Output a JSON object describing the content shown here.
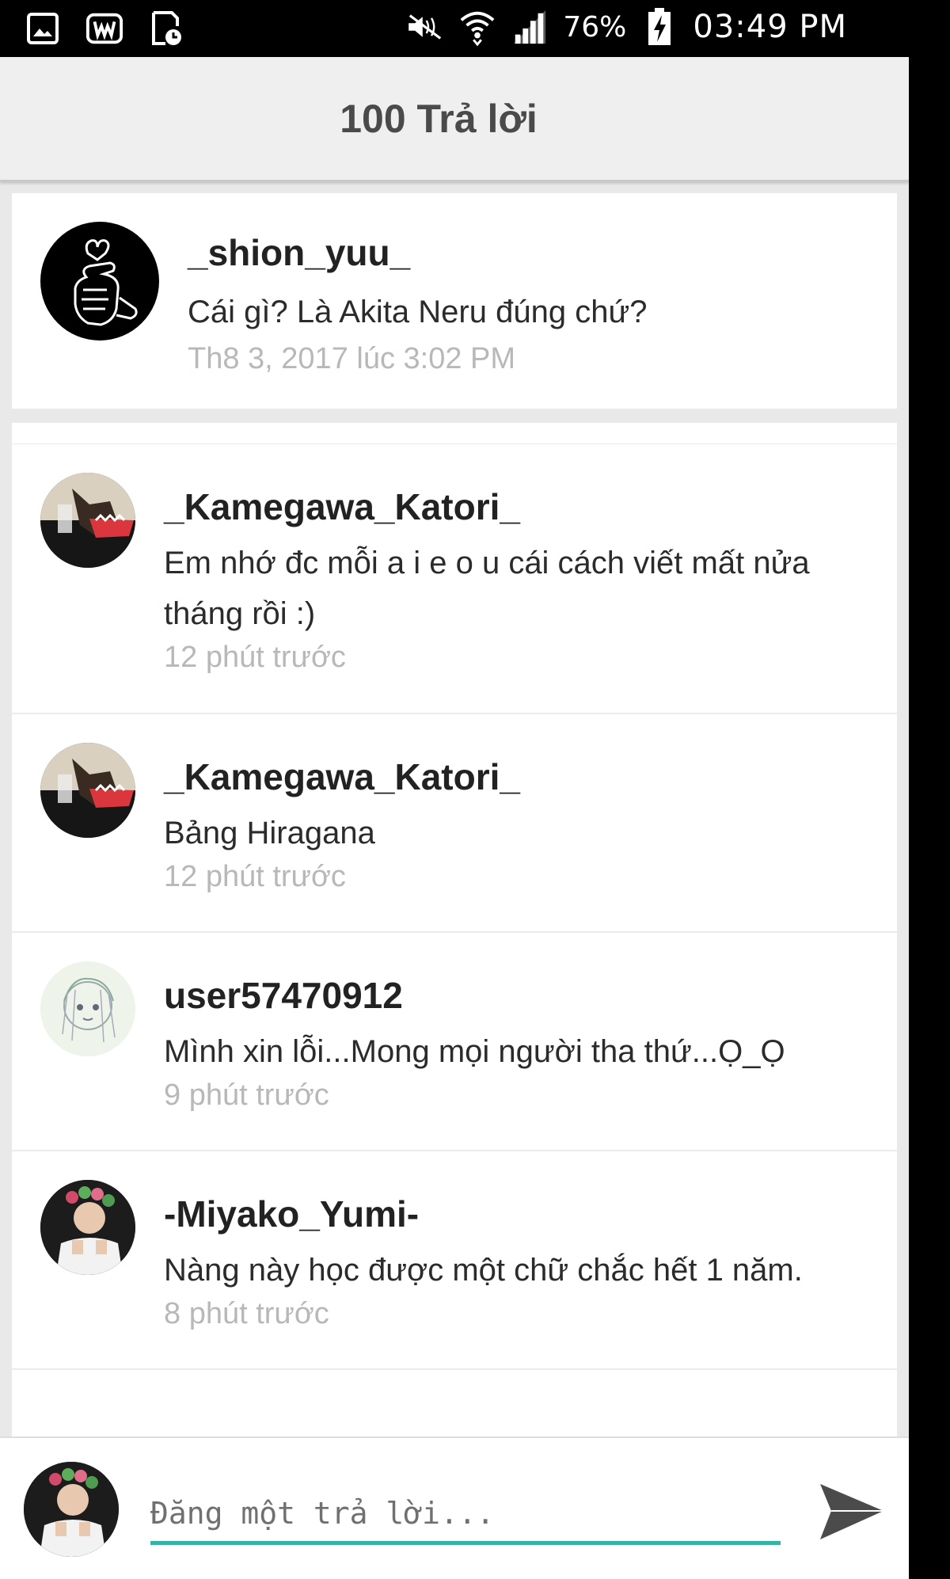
{
  "status_bar": {
    "battery_percent": "76%",
    "time": "03:49 PM",
    "icons": [
      "gallery-icon",
      "w-app-icon",
      "clock-file-icon",
      "mute-icon",
      "wifi-icon",
      "signal-icon",
      "battery-charging-icon"
    ]
  },
  "header": {
    "title": "100 Trả lời"
  },
  "post": {
    "username": "_shion_yuu_",
    "message": "Cái gì? Là Akita Neru đúng chứ?",
    "time": "Th8 3, 2017 lúc 3:02 PM"
  },
  "replies": [
    {
      "username": "_Kamegawa_Katori_",
      "message": "Em nhớ đc mỗi a i e o u cái cách viết mất nửa tháng rồi :)",
      "time": "12 phút trước"
    },
    {
      "username": "_Kamegawa_Katori_",
      "message": "Bảng Hiragana",
      "time": "12 phút trước"
    },
    {
      "username": "user57470912",
      "message": "Mình xin lỗi...Mong mọi người tha thứ...Ọ_Ọ",
      "time": "9 phút trước"
    },
    {
      "username": "-Miyako_Yumi-",
      "message": "Nàng này học được một chữ chắc hết 1 năm.",
      "time": "8 phút trước"
    }
  ],
  "compose": {
    "placeholder": "Đăng một trả lời...",
    "value": ""
  },
  "colors": {
    "accent": "#34b3a6",
    "send": "#4b4b4b"
  }
}
